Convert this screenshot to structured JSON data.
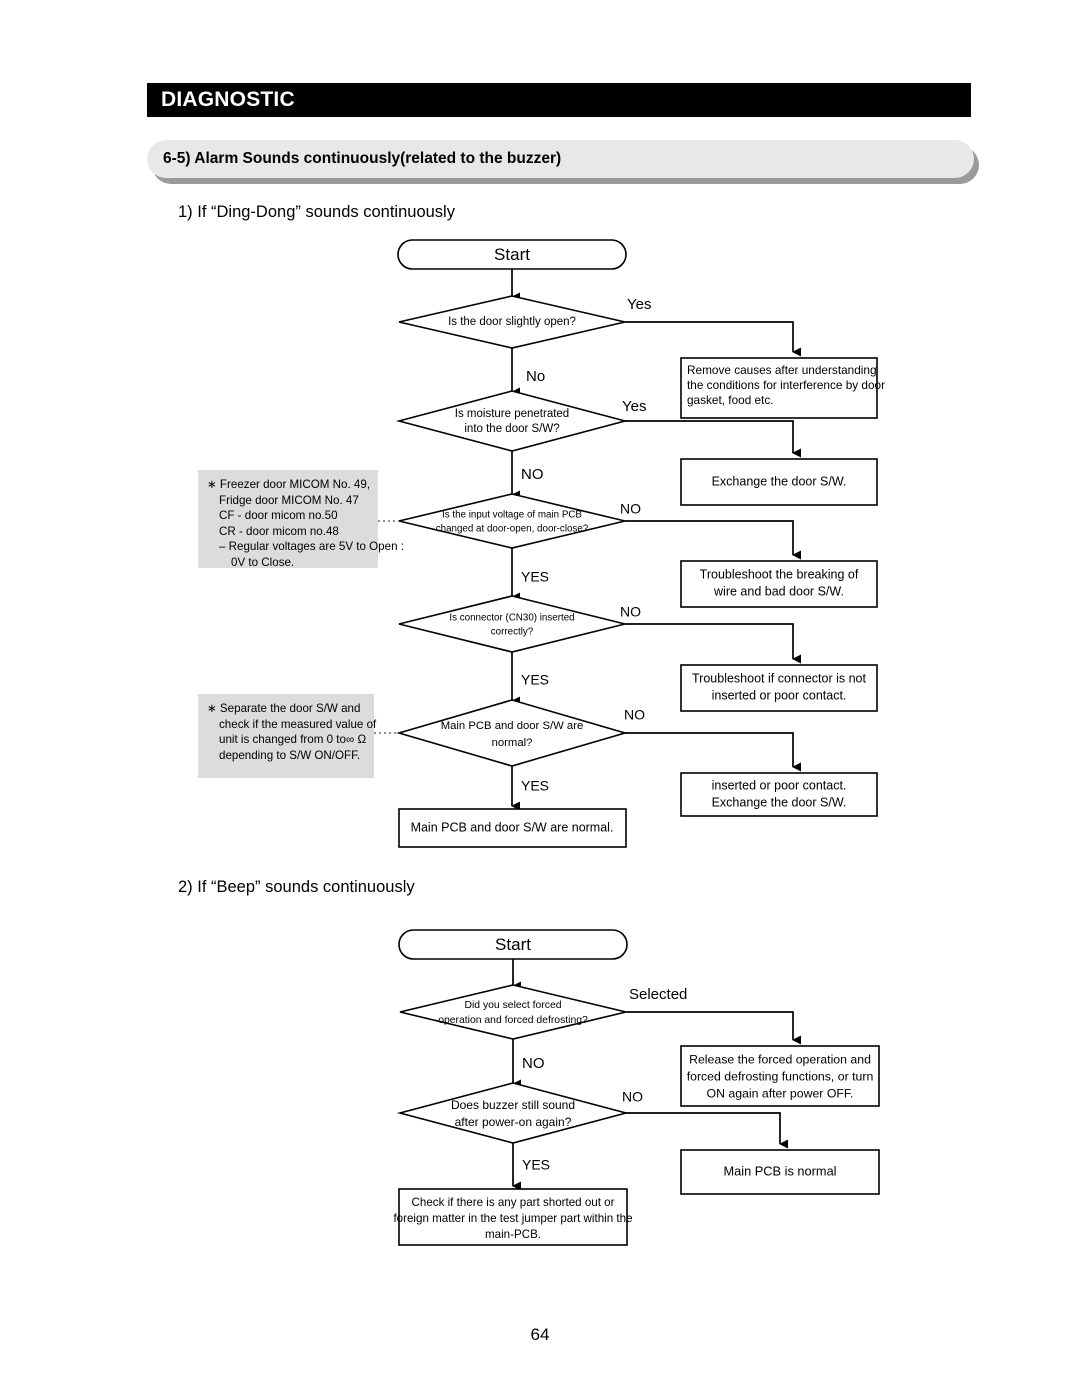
{
  "header": {
    "title": "DIAGNOSTIC"
  },
  "section": {
    "label": "6-5) Alarm Sounds continuously(related to the buzzer)"
  },
  "subheadings": {
    "first": "1) If “Ding-Dong” sounds continuously",
    "second": "2) If “Beep” sounds continuously"
  },
  "page_number": "64",
  "flowchart_1": {
    "start": "Start",
    "decisions": [
      {
        "id": "d1",
        "lines": [
          "Is the door slightly open?"
        ],
        "yes_label": "Yes",
        "no_label": "No"
      },
      {
        "id": "d2",
        "lines": [
          "Is moisture penetrated",
          "into the door S/W?"
        ],
        "yes_label": "Yes",
        "no_label": "NO"
      },
      {
        "id": "d3",
        "lines": [
          "Is the input voltage of main PCB",
          "changed at door-open, door-close?"
        ],
        "yes_label": "NO",
        "no_label": "YES"
      },
      {
        "id": "d4",
        "lines": [
          "Is connector (CN30) inserted",
          "correctly?"
        ],
        "yes_label": "NO",
        "no_label": "YES"
      },
      {
        "id": "d5",
        "lines": [
          "Main PCB and door S/W are",
          "normal?"
        ],
        "yes_label": "NO",
        "no_label": "YES"
      }
    ],
    "actions": [
      {
        "id": "a1",
        "lines": [
          "Remove causes after understanding",
          "the conditions for interference by door",
          "gasket, food etc."
        ],
        "align": "left"
      },
      {
        "id": "a2",
        "lines": [
          "Exchange the door S/W."
        ],
        "align": "center"
      },
      {
        "id": "a3",
        "lines": [
          "Troubleshoot the breaking of",
          "wire and bad door S/W."
        ],
        "align": "center"
      },
      {
        "id": "a4",
        "lines": [
          "Troubleshoot if connector is not",
          "inserted or poor contact."
        ],
        "align": "center"
      },
      {
        "id": "a5",
        "lines": [
          "inserted or poor contact.",
          "Exchange the door S/W."
        ],
        "align": "center"
      }
    ],
    "terminal": {
      "id": "t1",
      "lines": [
        "Main PCB and door S/W are normal."
      ]
    }
  },
  "flowchart_2": {
    "start": "Start",
    "decisions": [
      {
        "id": "e1",
        "lines": [
          "Did you select forced",
          "operation  and forced defrosting?"
        ],
        "yes_label": "Selected",
        "no_label": "NO"
      },
      {
        "id": "e2",
        "lines": [
          "Does buzzer still sound",
          "after power-on again?"
        ],
        "yes_label": "NO",
        "no_label": "YES"
      }
    ],
    "actions": [
      {
        "id": "b1",
        "lines": [
          "Release the forced operation and",
          "forced defrosting functions, or turn",
          "ON again after power OFF."
        ],
        "align": "center"
      },
      {
        "id": "b2",
        "lines": [
          "Main PCB is normal"
        ],
        "align": "center"
      }
    ],
    "terminal": {
      "id": "t2",
      "lines": [
        "Check if there is any part shorted out or",
        "foreign matter in the test jumper part within the",
        "main-PCB."
      ]
    }
  },
  "notes": [
    {
      "id": "note-1",
      "lines": [
        "∗ Freezer door MICOM No. 49,",
        "Fridge door MICOM No. 47",
        "CF - door micom no.50",
        "CR - door micom no.48",
        "– Regular voltages are 5V to Open :",
        "0V to Close."
      ]
    },
    {
      "id": "note-2",
      "lines": [
        "∗ Separate the door S/W and",
        "check if the measured value of",
        "unit is changed from  0 to∞ Ω",
        "depending to S/W ON/OFF."
      ]
    }
  ],
  "colors": {
    "header_bg": "#000000",
    "header_text": "#ffffff",
    "section_bg": "#e8e8e8",
    "section_shadow": "#9a9a9a",
    "note_bg": "#dcdcdc",
    "line": "#000000"
  }
}
